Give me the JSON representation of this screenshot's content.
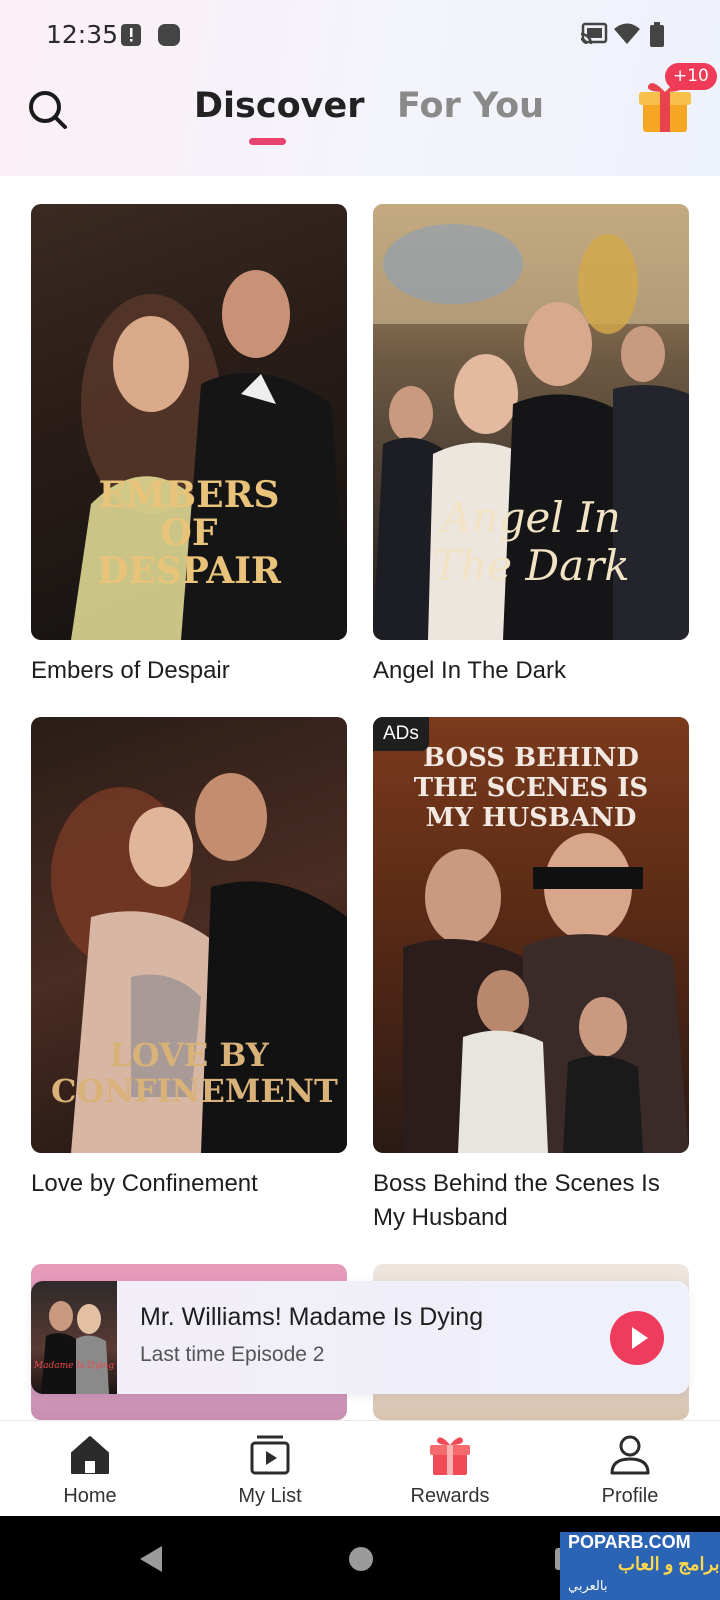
{
  "status_bar": {
    "time": "12:35"
  },
  "top_nav": {
    "tabs": [
      {
        "label": "Discover",
        "active": true
      },
      {
        "label": "For You",
        "active": false
      }
    ],
    "gift_badge": "+10",
    "accent_color": "#e8426e"
  },
  "dramas": [
    {
      "title": "Embers of Despair",
      "poster_text": "EMBERS OF DESPAIR",
      "ad": false
    },
    {
      "title": "Angel In The Dark",
      "poster_text": "Angel In The Dark",
      "ad": false
    },
    {
      "title": "Love by Confinement",
      "poster_text": "LOVE BY CONFINEMENT",
      "ad": false
    },
    {
      "title": "Boss Behind the Scenes Is My Husband",
      "poster_text": "BOSS BEHIND THE SCENES IS MY HUSBAND",
      "ad": true,
      "ad_label": "ADs"
    }
  ],
  "mini_player": {
    "title": "Mr. Williams! Madame Is Dying",
    "subtitle": "Last time Episode 2",
    "thumb_text": "Madame Is Dying"
  },
  "bottom_nav": {
    "items": [
      {
        "label": "Home",
        "icon": "home-icon",
        "active": true
      },
      {
        "label": "My List",
        "icon": "playlist-icon",
        "active": false
      },
      {
        "label": "Rewards",
        "icon": "gift-icon",
        "active": false
      },
      {
        "label": "Profile",
        "icon": "person-icon",
        "active": false
      }
    ]
  },
  "watermark": {
    "line1": "POPARB.COM",
    "line2": "برامج و العاب",
    "line3": "بالعربي"
  }
}
